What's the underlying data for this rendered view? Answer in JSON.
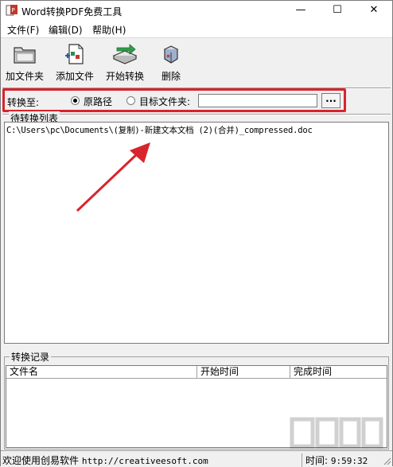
{
  "window": {
    "title": "Word转换PDF免费工具",
    "minimize": "—",
    "maximize": "☐",
    "close": "✕"
  },
  "menu": {
    "items": [
      "文件(F)",
      "编辑(D)",
      "帮助(H)"
    ]
  },
  "toolbar": {
    "add_folder": "加文件夹",
    "add_file": "添加文件",
    "start_convert": "开始转换",
    "delete": "删除"
  },
  "convert_to": {
    "label": "转换至:",
    "option_original": "原路径",
    "option_target": "目标文件夹:",
    "selected": "original",
    "target_path_value": "",
    "browse_label": "..."
  },
  "pending": {
    "title": "待转换列表",
    "files": [
      "C:\\Users\\pc\\Documents\\(复制)-新建文本文档 (2)(合并)_compressed.doc"
    ]
  },
  "log": {
    "title": "转换记录",
    "columns": [
      "文件名",
      "开始时间",
      "完成时间"
    ]
  },
  "status": {
    "welcome": "欢迎使用创易软件",
    "url": "http://creativeesoft.com",
    "time_label": "时间:",
    "time_value": "9:59:32"
  },
  "colors": {
    "highlight": "#d9232d",
    "arrow": "#d9232d"
  }
}
